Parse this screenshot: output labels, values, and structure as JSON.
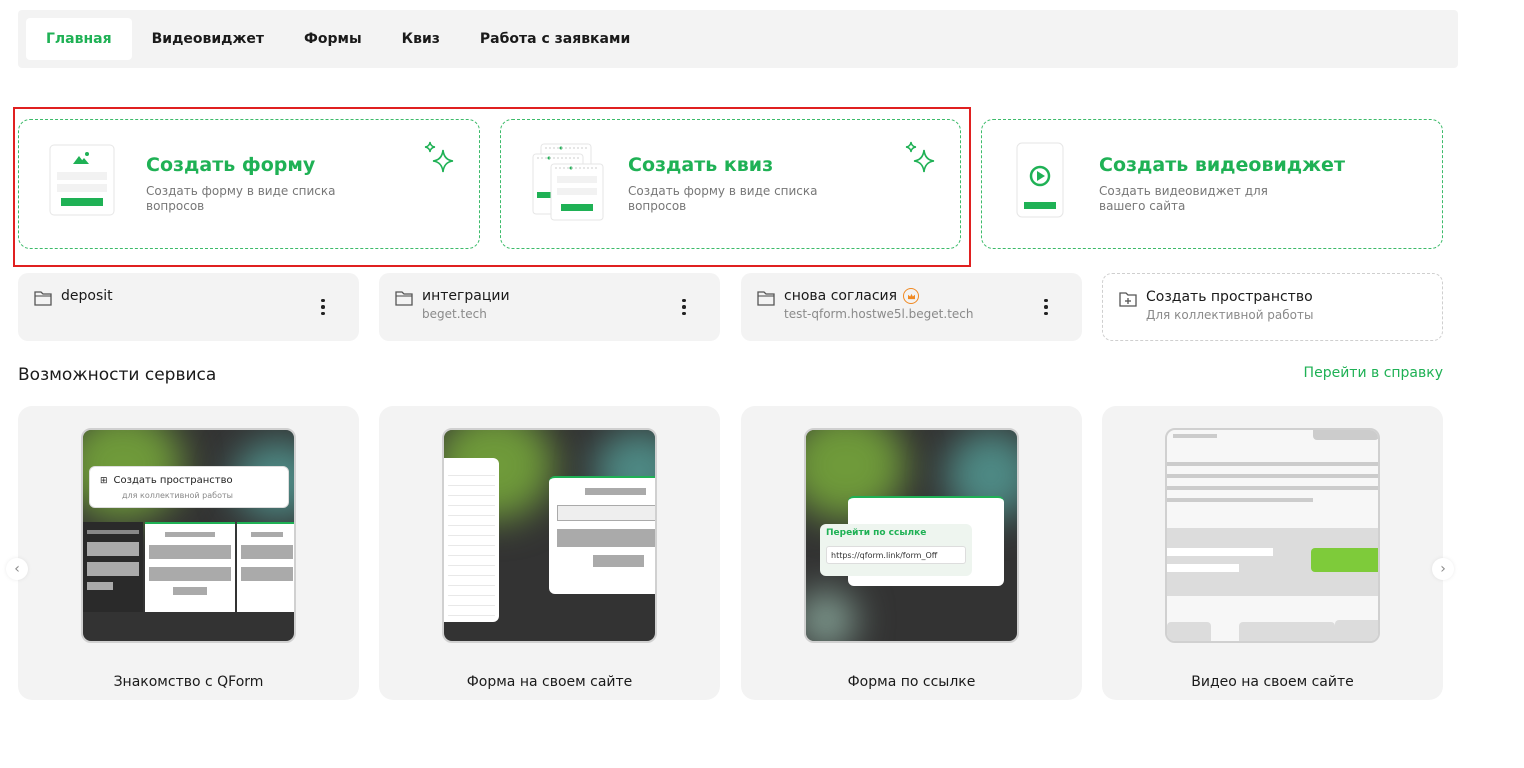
{
  "nav": {
    "tabs": [
      {
        "label": "Главная",
        "active": true
      },
      {
        "label": "Видеовиджет",
        "active": false
      },
      {
        "label": "Формы",
        "active": false
      },
      {
        "label": "Квиз",
        "active": false
      },
      {
        "label": "Работа с заявками",
        "active": false
      }
    ]
  },
  "create_cards": [
    {
      "title": "Создать форму",
      "desc": "Создать форму в виде списка вопросов"
    },
    {
      "title": "Создать квиз",
      "desc": "Создать форму в виде списка вопросов"
    },
    {
      "title": "Создать видеовиджет",
      "desc": "Создать видеовиджет для вашего сайта"
    }
  ],
  "folders": [
    {
      "name": "deposit",
      "sub": ""
    },
    {
      "name": "интеграции",
      "sub": "beget.tech"
    },
    {
      "name": "снова согласия",
      "sub": "test-qform.hostwe5l.beget.tech"
    }
  ],
  "create_space": {
    "title": "Создать пространство",
    "sub": "Для коллективной работы"
  },
  "section": {
    "title": "Возможности сервиса",
    "help_link": "Перейти в справку"
  },
  "features": [
    {
      "label": "Знакомство с QForm",
      "preview_title": "Создать пространство",
      "preview_sub": "для коллективной работы"
    },
    {
      "label": "Форма на своем сайте"
    },
    {
      "label": "Форма по ссылке",
      "preview_title": "Перейти по ссылке",
      "preview_url": "https://qform.link/form_Off"
    },
    {
      "label": "Видео на своем сайте"
    }
  ],
  "colors": {
    "accent": "#1fb155",
    "highlight": "#e02020",
    "card_bg": "#f3f3f3"
  }
}
